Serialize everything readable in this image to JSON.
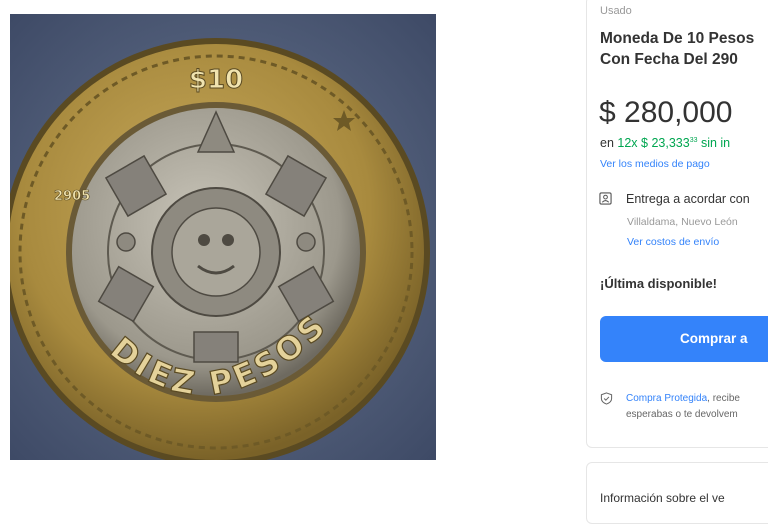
{
  "product": {
    "image_alt": "coin",
    "coin_text": {
      "denomination": "$10",
      "year": "2905",
      "words": "DIEZ PESOS"
    },
    "condition": "Usado",
    "title_line1": "Moneda De 10 Pesos",
    "title_line2": "Con Fecha Del 290",
    "price": "$ 280,000",
    "installments_prefix": "en ",
    "installments_amount": "12x $ 23,333",
    "installments_cents": "33",
    "installments_suffix": " sin in",
    "payment_link": "Ver los medios de pago"
  },
  "shipping": {
    "icon": "location-pin-icon",
    "title": "Entrega a acordar con",
    "location": "Villaldama, Nuevo León",
    "cost_link": "Ver costos de envío"
  },
  "stock": {
    "label": "¡Última disponible!"
  },
  "buy": {
    "label": "Comprar a"
  },
  "protection": {
    "icon": "shield-icon",
    "link": "Compra Protegida",
    "text_line1": ", recibe",
    "text_line2": "esperabas o te devolvem"
  },
  "seller": {
    "heading": "Información sobre el ve"
  },
  "colors": {
    "accent": "#3483fa",
    "green": "#00a650",
    "text": "#333333"
  }
}
